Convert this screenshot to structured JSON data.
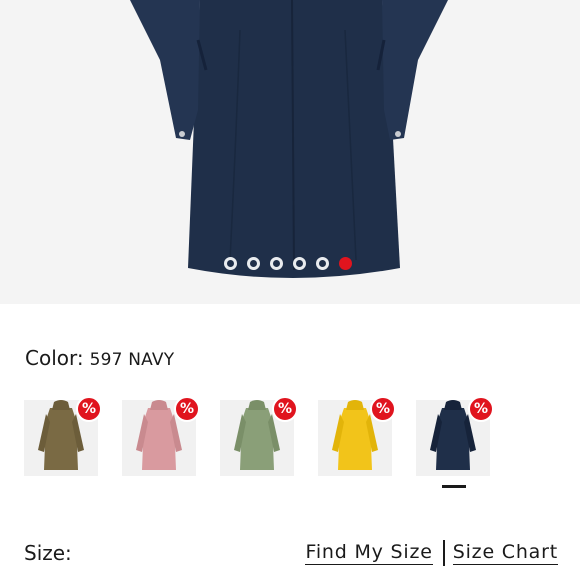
{
  "hero": {
    "image_icon": "navy-raincoat-image",
    "coat_color": "#1f2f49",
    "carousel": {
      "count": 6,
      "active_index": 5
    }
  },
  "color": {
    "label": "Color:",
    "value": "597 NAVY"
  },
  "swatches": [
    {
      "color": "#7a6a44",
      "badge": "%",
      "name": "brown"
    },
    {
      "color": "#d99a9f",
      "badge": "%",
      "name": "pink"
    },
    {
      "color": "#8a9f78",
      "badge": "%",
      "name": "sage-green"
    },
    {
      "color": "#f2c41a",
      "badge": "%",
      "name": "yellow"
    },
    {
      "color": "#1f2f49",
      "badge": "%",
      "name": "navy",
      "selected": true
    }
  ],
  "size": {
    "label": "Size:",
    "find_my_size": "Find My Size",
    "size_chart": "Size Chart"
  },
  "accent_color": "#e0141e"
}
